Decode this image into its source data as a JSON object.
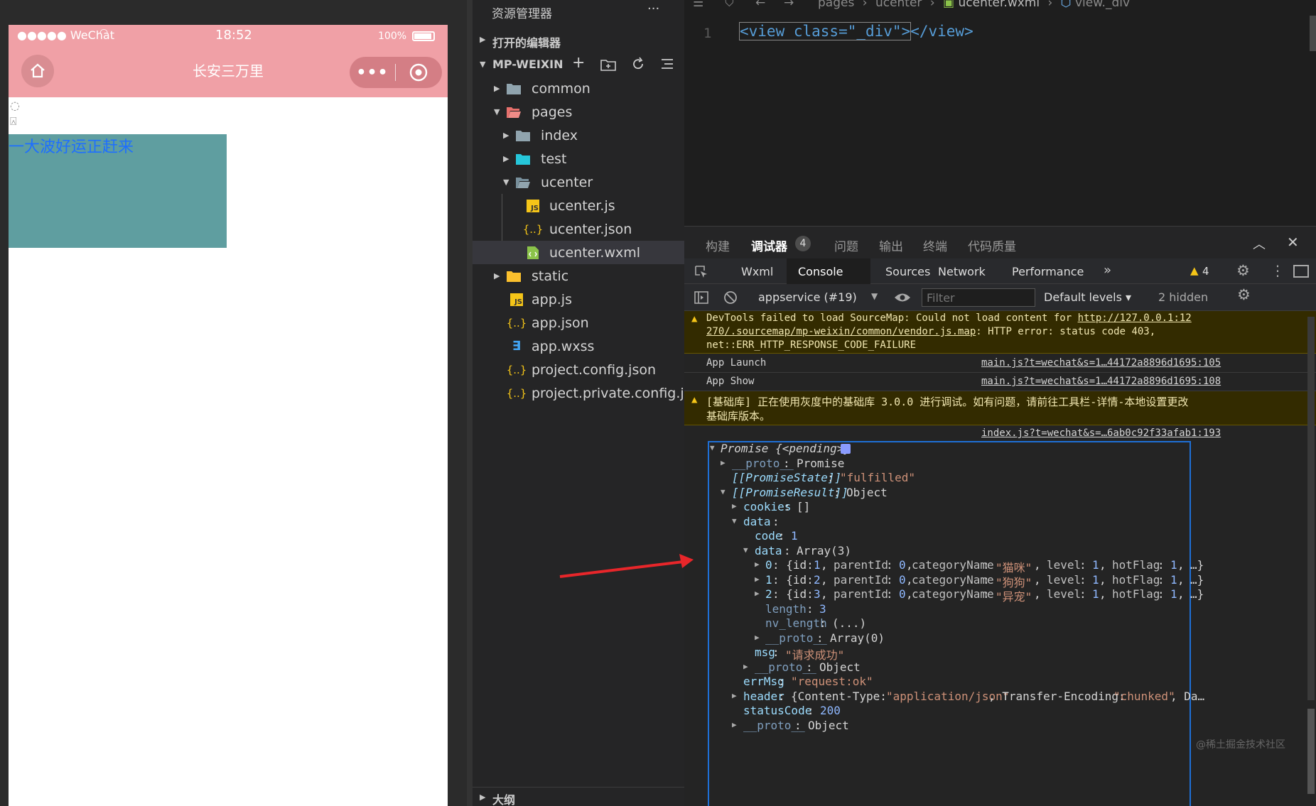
{
  "phone": {
    "status": {
      "signal": "●●●●● WeChat",
      "time": "18:52",
      "battery": "100%"
    },
    "nav_title": "长安三万里",
    "text_block": "一大波好运正赶来",
    "colors": {
      "bar": "#f0a0a6",
      "block": "#5f9ea0",
      "text": "#1e6fff"
    }
  },
  "explorer": {
    "header": "资源管理器",
    "more": "···",
    "open_editors": "打开的编辑器",
    "project": "MP-WEIXIN",
    "outline": "大纲",
    "items": [
      {
        "label": "common",
        "icon": "folder-icon"
      },
      {
        "label": "pages",
        "icon": "folder-open-icon"
      },
      {
        "label": "index",
        "icon": "folder-icon"
      },
      {
        "label": "test",
        "icon": "folder-test-icon"
      },
      {
        "label": "ucenter",
        "icon": "folder-open-icon"
      },
      {
        "label": "ucenter.js",
        "icon": "js-file-icon"
      },
      {
        "label": "ucenter.json",
        "icon": "json-file-icon"
      },
      {
        "label": "ucenter.wxml",
        "icon": "wxml-file-icon"
      },
      {
        "label": "static",
        "icon": "folder-icon"
      },
      {
        "label": "app.js",
        "icon": "js-file-icon"
      },
      {
        "label": "app.json",
        "icon": "json-file-icon"
      },
      {
        "label": "app.wxss",
        "icon": "css-file-icon"
      },
      {
        "label": "project.config.json",
        "icon": "json-file-icon"
      },
      {
        "label": "project.private.config.js...",
        "icon": "json-file-icon"
      }
    ]
  },
  "editor": {
    "breadcrumb": [
      "pages",
      "ucenter",
      "ucenter.wxml",
      "view._div"
    ],
    "line_number": "1",
    "code_open": "<view class=\"_div\">",
    "code_close": "</view>"
  },
  "devtools": {
    "panel_tabs": [
      "构建",
      "调试器",
      "问题",
      "输出",
      "终端",
      "代码质量"
    ],
    "debugger_badge": "4",
    "tool_tabs": [
      "Wxml",
      "Console",
      "Sources",
      "Network",
      "Performance"
    ],
    "more_tabs": "»",
    "warn_count": "4",
    "context": "appservice (#19)",
    "filter_placeholder": "Filter",
    "levels": "Default levels ▾",
    "hidden": "2 hidden",
    "watermark": "@稀土掘金技术社区"
  },
  "console": {
    "warning1": {
      "l1a": "DevTools failed to load SourceMap: Could not load content for ",
      "l1b": "http://127.0.0.1:12",
      "l2a": "270/.sourcemap/mp-weixin/common/vendor.js.map",
      "l2b": ": HTTP error: status code 403,",
      "l3": "net::ERR_HTTP_RESPONSE_CODE_FAILURE"
    },
    "launch": {
      "text": "App Launch",
      "src": "main.js?t=wechat&s=1…44172a8896d1695:105"
    },
    "show": {
      "text": "App Show",
      "src": "main.js?t=wechat&s=1…44172a8896d1695:108"
    },
    "warning2": {
      "l1": "[基础库] 正在使用灰度中的基础库 3.0.0 进行调试。如有问题，请前往工具栏-详情-本地设置更改",
      "l2": "基础库版本。"
    },
    "index_src": "index.js?t=wechat&s=…6ab0c92f33afab1:193",
    "tree": {
      "promise": "Promise {<pending>}",
      "proto_key": "__proto__",
      "proto_promise": "Promise",
      "state_key": "[[PromiseState]]",
      "state_val": "\"fulfilled\"",
      "result_key": "[[PromiseResult]]",
      "object": "Object",
      "cookies_key": "cookies",
      "cookies_val": "[]",
      "data_key": "data",
      "code_key": "code",
      "code_val": "1",
      "array3": "Array(3)",
      "rows": [
        {
          "idx": "0",
          "id": "1",
          "name": "\"猫咪\""
        },
        {
          "idx": "1",
          "id": "2",
          "name": "\"狗狗\""
        },
        {
          "idx": "2",
          "id": "3",
          "name": "\"异宠\""
        }
      ],
      "row_parent": "parentId",
      "row_parent_val": "0",
      "row_cat": "categoryName",
      "row_level": "level",
      "row_level_val": "1",
      "row_hot": "hotFlag",
      "row_hot_val": "1",
      "row_tail": "…}",
      "length_key": "length",
      "length_val": "3",
      "nvlen_key": "nv_length",
      "nvlen_val": "(...)",
      "array0": "Array(0)",
      "msg_key": "msg",
      "msg_val": "\"请求成功\"",
      "errmsg_key": "errMsg",
      "errmsg_val": "\"request:ok\"",
      "header_key": "header",
      "header_val_a": "{Content-Type: ",
      "header_val_b": "\"application/json\"",
      "header_val_c": ", Transfer-Encoding: ",
      "header_val_d": "\"chunked\"",
      "header_val_e": ", Da…",
      "status_key": "statusCode",
      "status_val": "200"
    }
  }
}
